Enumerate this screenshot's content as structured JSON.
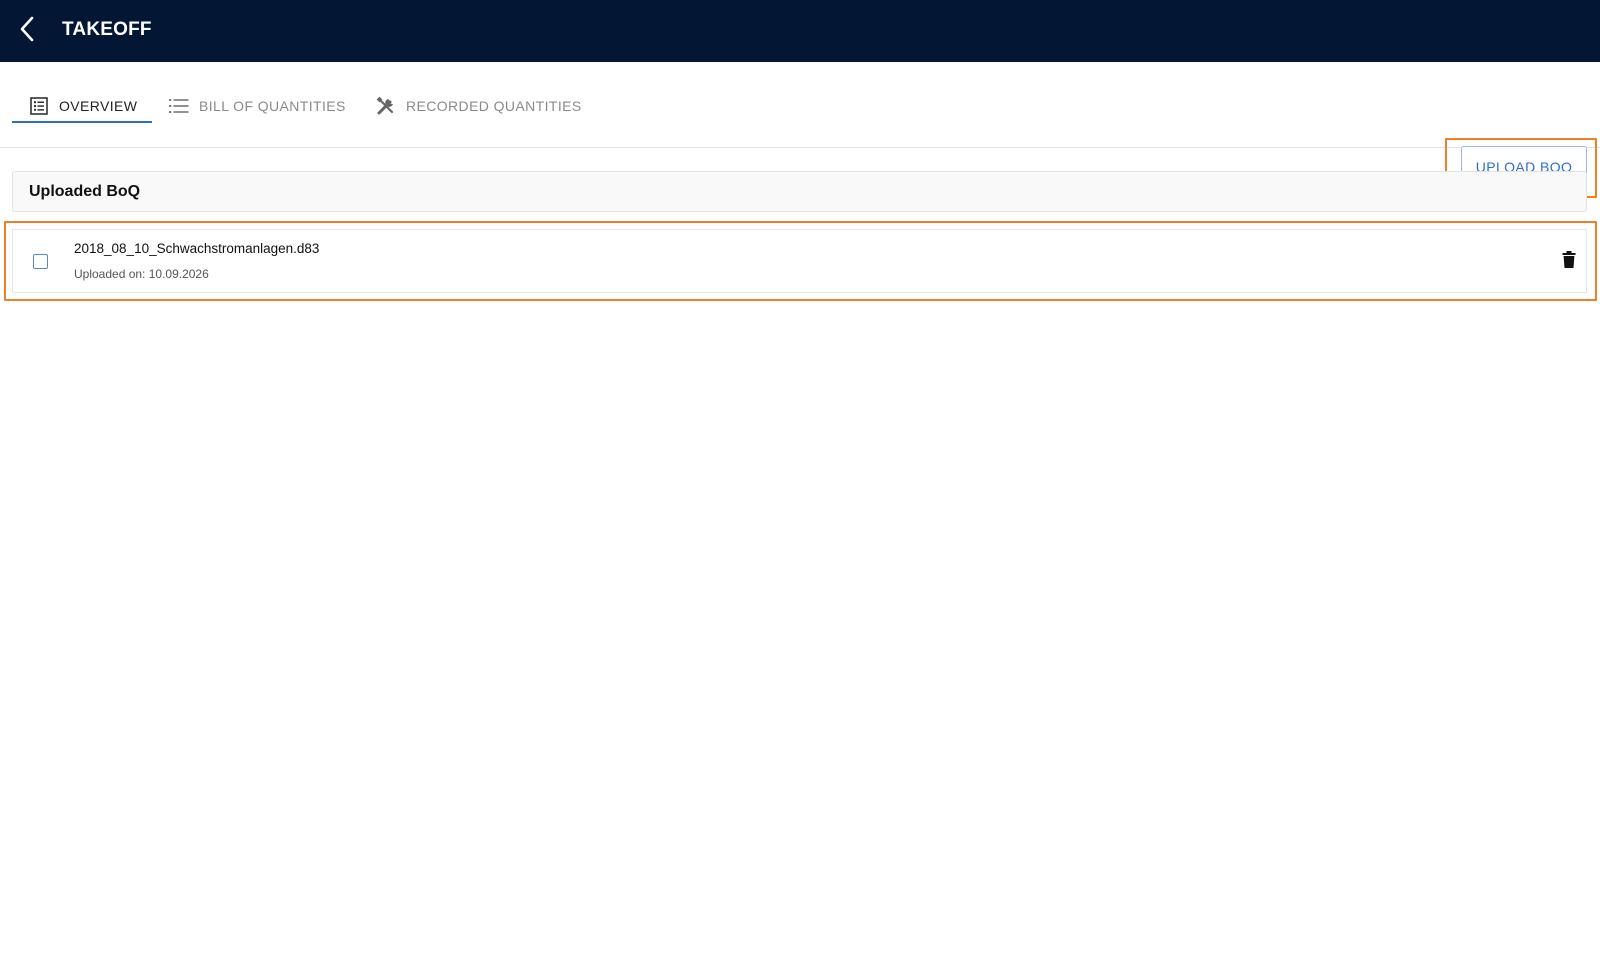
{
  "header": {
    "title": "TAKEOFF",
    "back_icon": "chevron-left-icon"
  },
  "tabs": [
    {
      "label": "OVERVIEW",
      "icon": "list-box-icon",
      "active": true
    },
    {
      "label": "BILL OF QUANTITIES",
      "icon": "list-icon",
      "active": false
    },
    {
      "label": "RECORDED QUANTITIES",
      "icon": "tools-icon",
      "active": false
    }
  ],
  "toolbar": {
    "upload_label": "UPLOAD BOQ"
  },
  "section": {
    "title": "Uploaded BoQ"
  },
  "files": [
    {
      "name": "2018_08_10_Schwachstromanlagen.d83",
      "uploaded": "Uploaded on: 10.09.2026",
      "checked": false,
      "delete_icon": "trash-icon"
    }
  ],
  "colors": {
    "header_bg": "#031634",
    "accent": "#2f6bd6",
    "highlight": "#f07f26"
  }
}
